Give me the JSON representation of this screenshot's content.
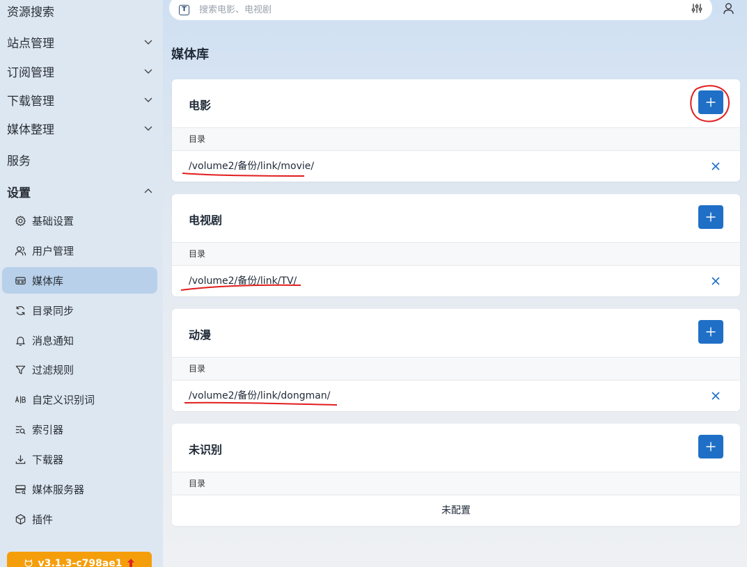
{
  "sidebar": {
    "top_items": [
      {
        "label": "资源搜索",
        "has_chevron": false
      },
      {
        "label": "站点管理",
        "has_chevron": true
      },
      {
        "label": "订阅管理",
        "has_chevron": true
      },
      {
        "label": "下载管理",
        "has_chevron": true
      },
      {
        "label": "媒体整理",
        "has_chevron": true
      },
      {
        "label": "服务",
        "has_chevron": false
      },
      {
        "label": "设置",
        "has_chevron": true,
        "expanded": true
      }
    ],
    "sub_items": [
      {
        "label": "基础设置",
        "icon": "gear-icon"
      },
      {
        "label": "用户管理",
        "icon": "users-icon"
      },
      {
        "label": "媒体库",
        "icon": "media-library-icon",
        "active": true
      },
      {
        "label": "目录同步",
        "icon": "sync-icon"
      },
      {
        "label": "消息通知",
        "icon": "bell-icon"
      },
      {
        "label": "过滤规则",
        "icon": "filter-icon"
      },
      {
        "label": "自定义识别词",
        "icon": "ab-icon"
      },
      {
        "label": "索引器",
        "icon": "indexer-icon"
      },
      {
        "label": "下载器",
        "icon": "download-icon"
      },
      {
        "label": "媒体服务器",
        "icon": "server-icon"
      },
      {
        "label": "插件",
        "icon": "plugin-icon"
      }
    ],
    "version_label": "v3.1.3-c798ae1"
  },
  "search": {
    "placeholder": "搜索电影、电视剧"
  },
  "page": {
    "title": "媒体库"
  },
  "cards": [
    {
      "title": "电影",
      "dir_header": "目录",
      "dir": "/volume2/备份/link/movie/"
    },
    {
      "title": "电视剧",
      "dir_header": "目录",
      "dir": "/volume2/备份/link/TV/"
    },
    {
      "title": "动漫",
      "dir_header": "目录",
      "dir": "/volume2/备份/link/dongman/"
    },
    {
      "title": "未识别",
      "dir_header": "目录",
      "empty_text": "未配置"
    }
  ],
  "colors": {
    "accent": "#1f6fc7",
    "active_item": "#b8d0ea",
    "version_button": "#f59e0b",
    "annotation": "#e11d1d"
  }
}
